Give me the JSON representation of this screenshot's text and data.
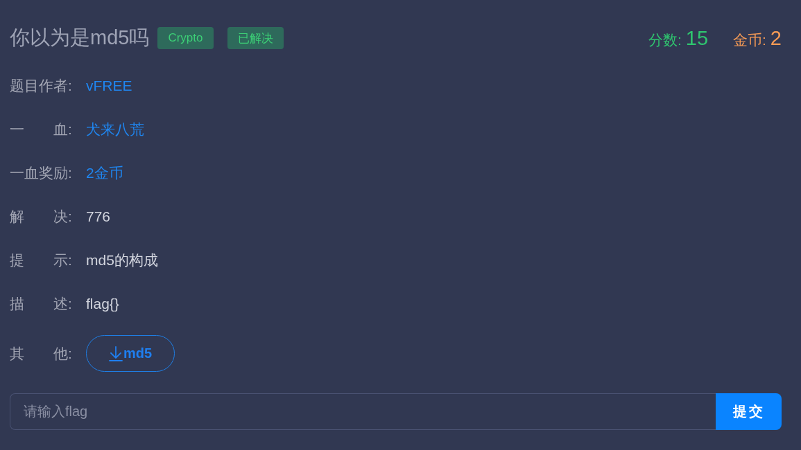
{
  "challenge": {
    "title": "你以为是md5吗",
    "tags": [
      {
        "label": "Crypto"
      },
      {
        "label": "已解决"
      }
    ]
  },
  "stats": [
    {
      "kind": "score",
      "label": "分数:",
      "value": "15"
    },
    {
      "kind": "coins",
      "label": "金币:",
      "value": "2"
    }
  ],
  "details": [
    {
      "label": "题目作者:",
      "kind": "link",
      "value": "vFREE"
    },
    {
      "label": "一　　血:",
      "kind": "link",
      "value": "犬来八荒"
    },
    {
      "label": "一血奖励:",
      "kind": "link",
      "value": "2金币"
    },
    {
      "label": "解　　决:",
      "kind": "text",
      "value": "776"
    },
    {
      "label": "提　　示:",
      "kind": "text",
      "value": "md5的构成"
    },
    {
      "label": "描　　述:",
      "kind": "text",
      "value": "flag{}"
    },
    {
      "label": "其　　他:",
      "kind": "download",
      "value": "md5"
    }
  ],
  "flag_form": {
    "placeholder": "请输入flag",
    "submit": "提交"
  }
}
